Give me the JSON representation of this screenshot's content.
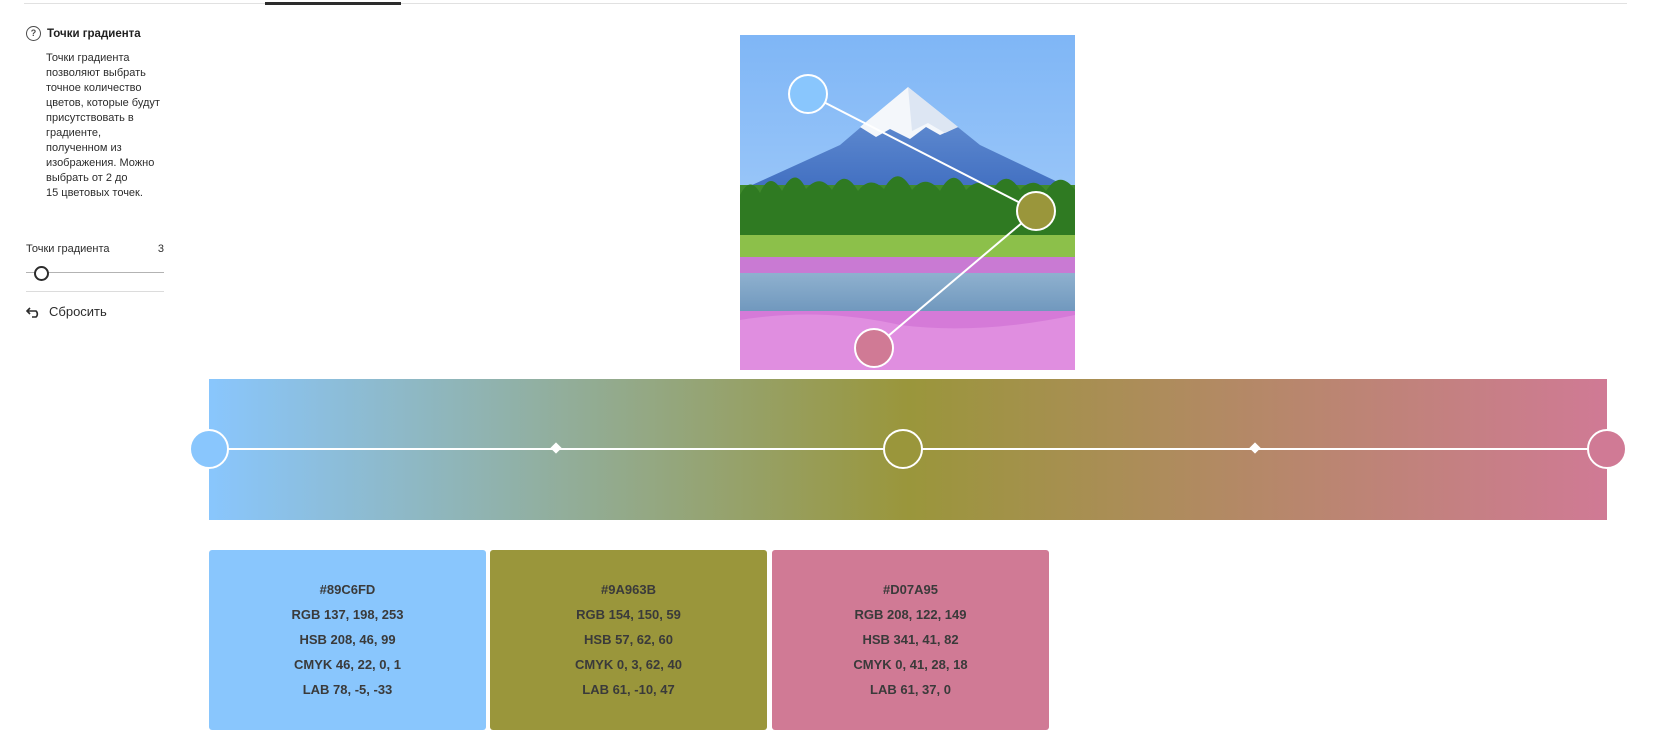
{
  "sidebar": {
    "help_title": "Точки градиента",
    "help_text": "Точки градиента\nпозволяют выбрать\nточное количество\nцветов, которые будут\nприсутствовать в\nградиенте,\nполученном из\nизображения. Можно\nвыбрать от 2 до\n15 цветовых точек.",
    "stops_label": "Точки градиента",
    "stops_value": "3",
    "reset_label": "Сбросить"
  },
  "gradient": {
    "stop_count": 3,
    "stops": [
      "#89C6FD",
      "#9A963B",
      "#D07A95"
    ]
  },
  "swatches": [
    {
      "color": "#89C6FD",
      "hex": "#89C6FD",
      "rgb": "RGB 137, 198, 253",
      "hsb": "HSB 208, 46, 99",
      "cmyk": "CMYK 46, 22, 0, 1",
      "lab": "LAB 78, -5, -33"
    },
    {
      "color": "#9A963B",
      "hex": "#9A963B",
      "rgb": "RGB 154, 150, 59",
      "hsb": "HSB 57, 62, 60",
      "cmyk": "CMYK 0, 3, 62, 40",
      "lab": "LAB 61, -10, 47"
    },
    {
      "color": "#D07A95",
      "hex": "#D07A95",
      "rgb": "RGB 208, 122, 149",
      "hsb": "HSB 341, 41, 82",
      "cmyk": "CMYK 0, 41, 28, 18",
      "lab": "LAB 61, 37, 0"
    }
  ]
}
